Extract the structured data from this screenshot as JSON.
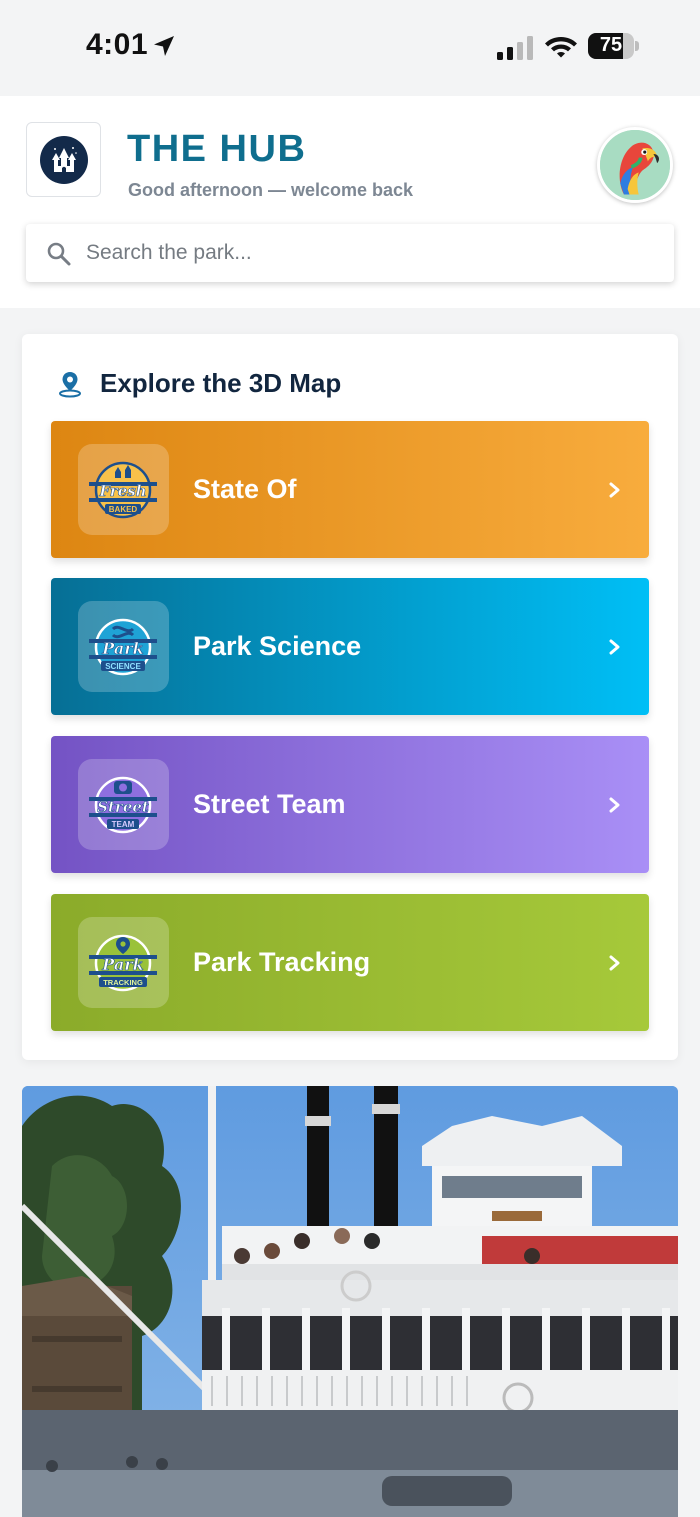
{
  "status_bar": {
    "time": "4:01",
    "battery": "75",
    "battery_level": 0.75,
    "icons": [
      "location-arrow-icon",
      "cellular-signal-icon",
      "wifi-icon",
      "battery-icon"
    ]
  },
  "header": {
    "title": "THE HUB",
    "subtitle": "Good afternoon — welcome back",
    "logo_icon": "castle-logo-icon",
    "avatar_icon": "parrot-avatar"
  },
  "search": {
    "placeholder": "Search the park...",
    "value": ""
  },
  "map_section": {
    "heading": "Explore the 3D Map",
    "heading_icon": "map-pin-icon",
    "tiles": [
      {
        "label": "State Of",
        "badge": "Fresh Baked",
        "badge_small": "BAKED",
        "badge_big": "Fresh",
        "color_start": "#dd8612",
        "color_end": "#f8ac3d"
      },
      {
        "label": "Park Science",
        "badge": "Park Science",
        "badge_small": "SCIENCE",
        "badge_big": "Park",
        "color_start": "#066f95",
        "color_end": "#00bff6"
      },
      {
        "label": "Street Team",
        "badge": "Street Team",
        "badge_small": "TEAM",
        "badge_big": "Street",
        "color_start": "#7453c4",
        "color_end": "#a98ff6"
      },
      {
        "label": "Park Tracking",
        "badge": "Park Tracking",
        "badge_small": "TRACKING",
        "badge_big": "Park",
        "color_start": "#8bab2a",
        "color_end": "#a6c93a"
      }
    ]
  },
  "photo": {
    "subject": "riverboat-photo"
  },
  "colors": {
    "accent": "#0f6e8e",
    "heading": "#12263f",
    "muted": "#7d8793",
    "background": "#f3f4f5"
  }
}
